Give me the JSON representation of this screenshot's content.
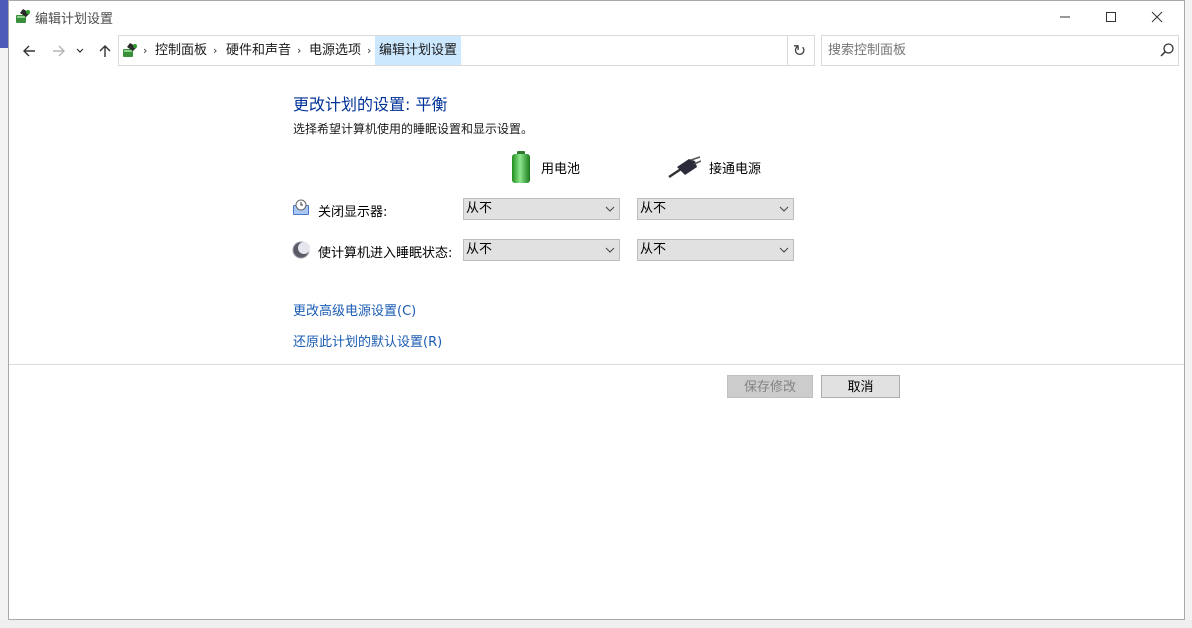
{
  "window": {
    "title": "编辑计划设置"
  },
  "address_bar": {
    "breadcrumbs": [
      "控制面板",
      "硬件和声音",
      "电源选项",
      "编辑计划设置"
    ]
  },
  "search": {
    "placeholder": "搜索控制面板"
  },
  "page": {
    "heading": "更改计划的设置: 平衡",
    "subtitle": "选择希望计算机使用的睡眠设置和显示设置。",
    "columns": {
      "battery": "用电池",
      "plugged": "接通电源"
    },
    "rows": [
      {
        "label": "关闭显示器:",
        "battery_value": "从不",
        "plugged_value": "从不"
      },
      {
        "label": "使计算机进入睡眠状态:",
        "battery_value": "从不",
        "plugged_value": "从不"
      }
    ],
    "links": {
      "advanced": "更改高级电源设置(C)",
      "restore": "还原此计划的默认设置(R)"
    },
    "buttons": {
      "save": "保存修改",
      "cancel": "取消"
    }
  },
  "colors": {
    "heading": "#003399",
    "link": "#1a5cb3",
    "selected_crumb": "#cce8ff"
  }
}
